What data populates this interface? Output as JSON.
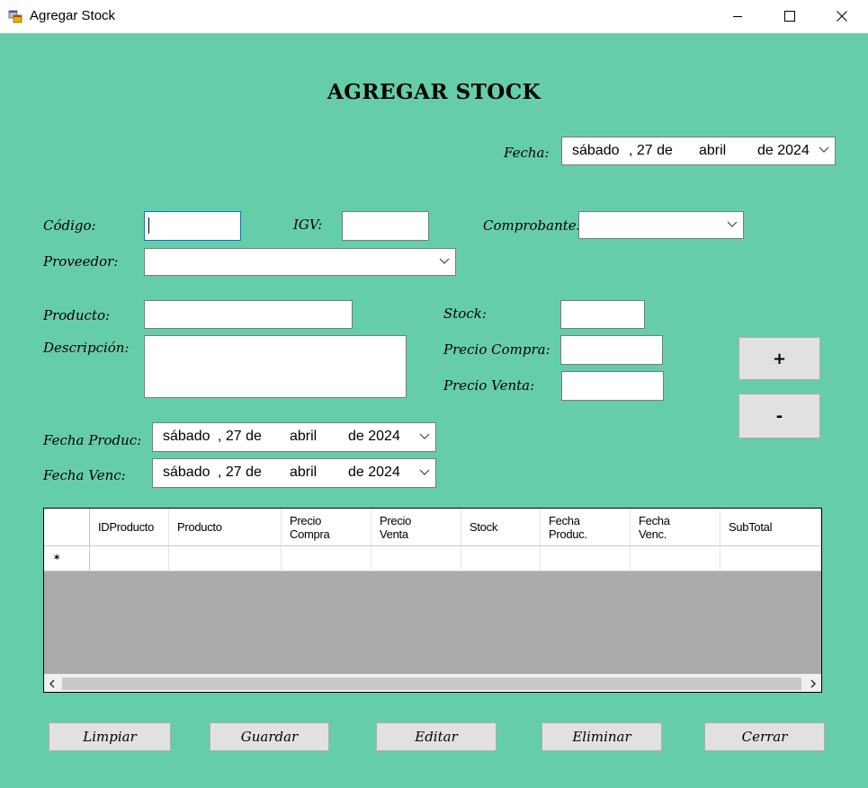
{
  "window": {
    "title": "Agregar Stock",
    "controls": {
      "minimize": "minimize",
      "maximize": "maximize",
      "close": "close"
    }
  },
  "form": {
    "heading": "AGREGAR STOCK",
    "fecha_label": "Fecha:",
    "fecha": {
      "day": "sábado",
      "num": ", 27 de",
      "month": "abril",
      "year": "de 2024"
    },
    "codigo_label": "Código:",
    "codigo_value": "",
    "igv_label": "IGV:",
    "igv_value": "",
    "comprobante_label": "Comprobante:",
    "comprobante_value": "",
    "proveedor_label": "Proveedor:",
    "proveedor_value": "",
    "producto_label": "Producto:",
    "producto_value": "",
    "descripcion_label": "Descripción:",
    "descripcion_value": "",
    "stock_label": "Stock:",
    "stock_value": "",
    "precio_compra_label": "Precio Compra:",
    "precio_compra_value": "",
    "precio_venta_label": "Precio Venta:",
    "precio_venta_value": "",
    "add_label": "+",
    "remove_label": "-",
    "fecha_produc_label": "Fecha Produc:",
    "fecha_produc": {
      "day": "sábado",
      "num": ", 27 de",
      "month": "abril",
      "year": "de 2024"
    },
    "fecha_venc_label": "Fecha Venc:",
    "fecha_venc": {
      "day": "sábado",
      "num": ", 27 de",
      "month": "abril",
      "year": "de 2024"
    }
  },
  "grid": {
    "columns": [
      "IDProducto",
      "Producto",
      "Precio\nCompra",
      "Precio\nVenta",
      "Stock",
      "Fecha\nProduc.",
      "Fecha\nVenc.",
      "SubTotal"
    ],
    "new_row_marker": "*",
    "rows": []
  },
  "buttons": {
    "limpiar": "Limpiar",
    "guardar": "Guardar",
    "editar": "Editar",
    "eliminar": "Eliminar",
    "cerrar": "Cerrar"
  },
  "colors": {
    "background": "#66cdaa",
    "button": "#e1e1e1",
    "grid_empty": "#ababab",
    "focus": "#0078d7"
  }
}
